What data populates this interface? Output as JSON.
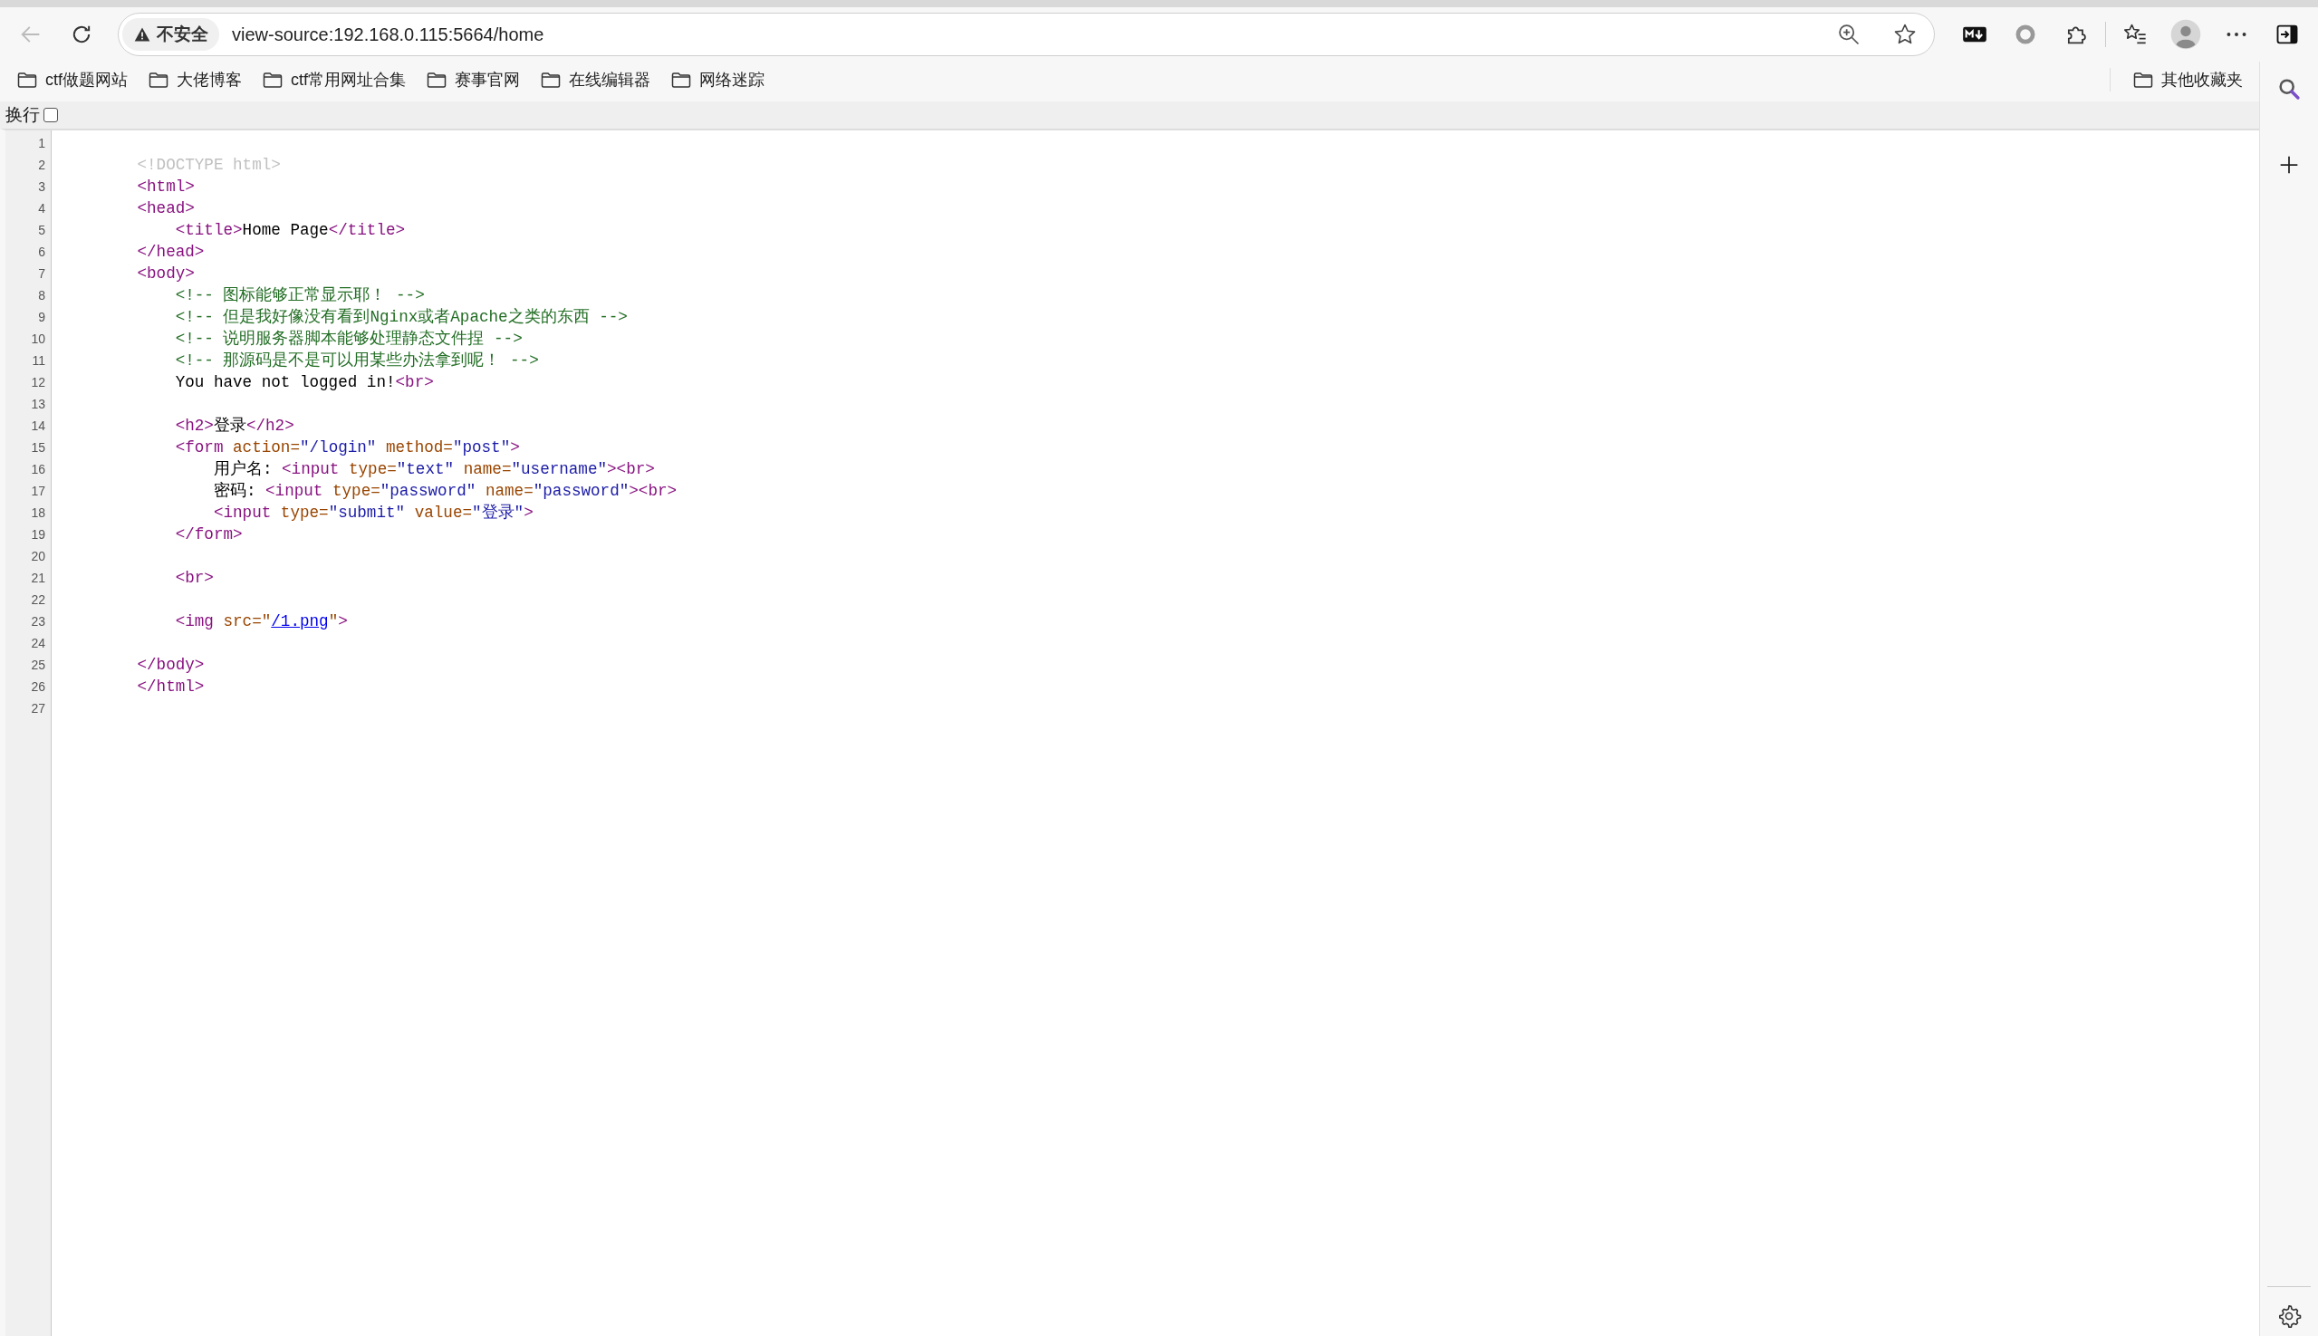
{
  "toolbar": {
    "back": {
      "disabled": true
    },
    "security_badge": "不安全",
    "url": "view-source:192.168.0.115:5664/home"
  },
  "bookmarks": [
    {
      "label": "ctf做题网站"
    },
    {
      "label": "大佬博客"
    },
    {
      "label": "ctf常用网址合集"
    },
    {
      "label": "赛事官网"
    },
    {
      "label": "在线编辑器"
    },
    {
      "label": "网络迷踪"
    }
  ],
  "other_bookmarks": {
    "label": "其他收藏夹"
  },
  "wrap_option": {
    "label": "换行",
    "checked": false
  },
  "source_lines": [
    {
      "number": "1"
    },
    {
      "number": "2",
      "tokens": [
        {
          "kind": "doctype",
          "text": "        <!DOCTYPE html>"
        }
      ]
    },
    {
      "number": "3",
      "tokens": [
        {
          "kind": "tag",
          "text": "        <html>"
        }
      ]
    },
    {
      "number": "4",
      "tokens": [
        {
          "kind": "tag",
          "text": "        <head>"
        }
      ]
    },
    {
      "number": "5",
      "tokens": [
        {
          "kind": "tag",
          "text": "            <title>"
        },
        {
          "kind": "text",
          "text": "Home Page"
        },
        {
          "kind": "tag",
          "text": "</title>"
        }
      ]
    },
    {
      "number": "6",
      "tokens": [
        {
          "kind": "tag",
          "text": "        </head>"
        }
      ]
    },
    {
      "number": "7",
      "tokens": [
        {
          "kind": "tag",
          "text": "        <body>"
        }
      ]
    },
    {
      "number": "8",
      "tokens": [
        {
          "kind": "comment",
          "text": "            <!-- 图标能够正常显示耶！ -->"
        }
      ]
    },
    {
      "number": "9",
      "tokens": [
        {
          "kind": "comment",
          "text": "            <!-- 但是我好像没有看到Nginx或者Apache之类的东西 -->"
        }
      ]
    },
    {
      "number": "10",
      "tokens": [
        {
          "kind": "comment",
          "text": "            <!-- 说明服务器脚本能够处理静态文件捏 -->"
        }
      ]
    },
    {
      "number": "11",
      "tokens": [
        {
          "kind": "comment",
          "text": "            <!-- 那源码是不是可以用某些办法拿到呢！ -->"
        }
      ]
    },
    {
      "number": "12",
      "tokens": [
        {
          "kind": "text",
          "text": "            You have not logged in!"
        },
        {
          "kind": "tag",
          "text": "<br>"
        }
      ]
    },
    {
      "number": "13"
    },
    {
      "number": "14",
      "tokens": [
        {
          "kind": "tag",
          "text": "            <h2>"
        },
        {
          "kind": "text",
          "text": "登录"
        },
        {
          "kind": "tag",
          "text": "</h2>"
        }
      ]
    },
    {
      "number": "15",
      "tokens": [
        {
          "kind": "tag",
          "text": "            <form "
        },
        {
          "kind": "attr",
          "text": "action="
        },
        {
          "kind": "value",
          "text": "\"/login\""
        },
        {
          "kind": "attr",
          "text": " method="
        },
        {
          "kind": "value",
          "text": "\"post\""
        },
        {
          "kind": "tag",
          "text": ">"
        }
      ]
    },
    {
      "number": "16",
      "tokens": [
        {
          "kind": "text",
          "text": "                用户名: "
        },
        {
          "kind": "tag",
          "text": "<input "
        },
        {
          "kind": "attr",
          "text": "type="
        },
        {
          "kind": "value",
          "text": "\"text\""
        },
        {
          "kind": "attr",
          "text": " name="
        },
        {
          "kind": "value",
          "text": "\"username\""
        },
        {
          "kind": "tag",
          "text": "><br>"
        }
      ]
    },
    {
      "number": "17",
      "tokens": [
        {
          "kind": "text",
          "text": "                密码: "
        },
        {
          "kind": "tag",
          "text": "<input "
        },
        {
          "kind": "attr",
          "text": "type="
        },
        {
          "kind": "value",
          "text": "\"password\""
        },
        {
          "kind": "attr",
          "text": " name="
        },
        {
          "kind": "value",
          "text": "\"password\""
        },
        {
          "kind": "tag",
          "text": "><br>"
        }
      ]
    },
    {
      "number": "18",
      "tokens": [
        {
          "kind": "tag",
          "text": "                <input "
        },
        {
          "kind": "attr",
          "text": "type="
        },
        {
          "kind": "value",
          "text": "\"submit\""
        },
        {
          "kind": "attr",
          "text": " value="
        },
        {
          "kind": "value",
          "text": "\"登录\""
        },
        {
          "kind": "tag",
          "text": ">"
        }
      ]
    },
    {
      "number": "19",
      "tokens": [
        {
          "kind": "tag",
          "text": "            </form>"
        }
      ]
    },
    {
      "number": "20"
    },
    {
      "number": "21",
      "tokens": [
        {
          "kind": "tag",
          "text": "            <br>"
        }
      ]
    },
    {
      "number": "22"
    },
    {
      "number": "23",
      "tokens": [
        {
          "kind": "tag",
          "text": "            <img "
        },
        {
          "kind": "attr",
          "text": "src=\""
        },
        {
          "kind": "link",
          "text": "/1.png"
        },
        {
          "kind": "attr",
          "text": "\""
        },
        {
          "kind": "tag",
          "text": ">"
        }
      ]
    },
    {
      "number": "24"
    },
    {
      "number": "25",
      "tokens": [
        {
          "kind": "tag",
          "text": "        </body>"
        }
      ]
    },
    {
      "number": "26",
      "tokens": [
        {
          "kind": "tag",
          "text": "        </html>"
        }
      ]
    },
    {
      "number": "27"
    }
  ]
}
